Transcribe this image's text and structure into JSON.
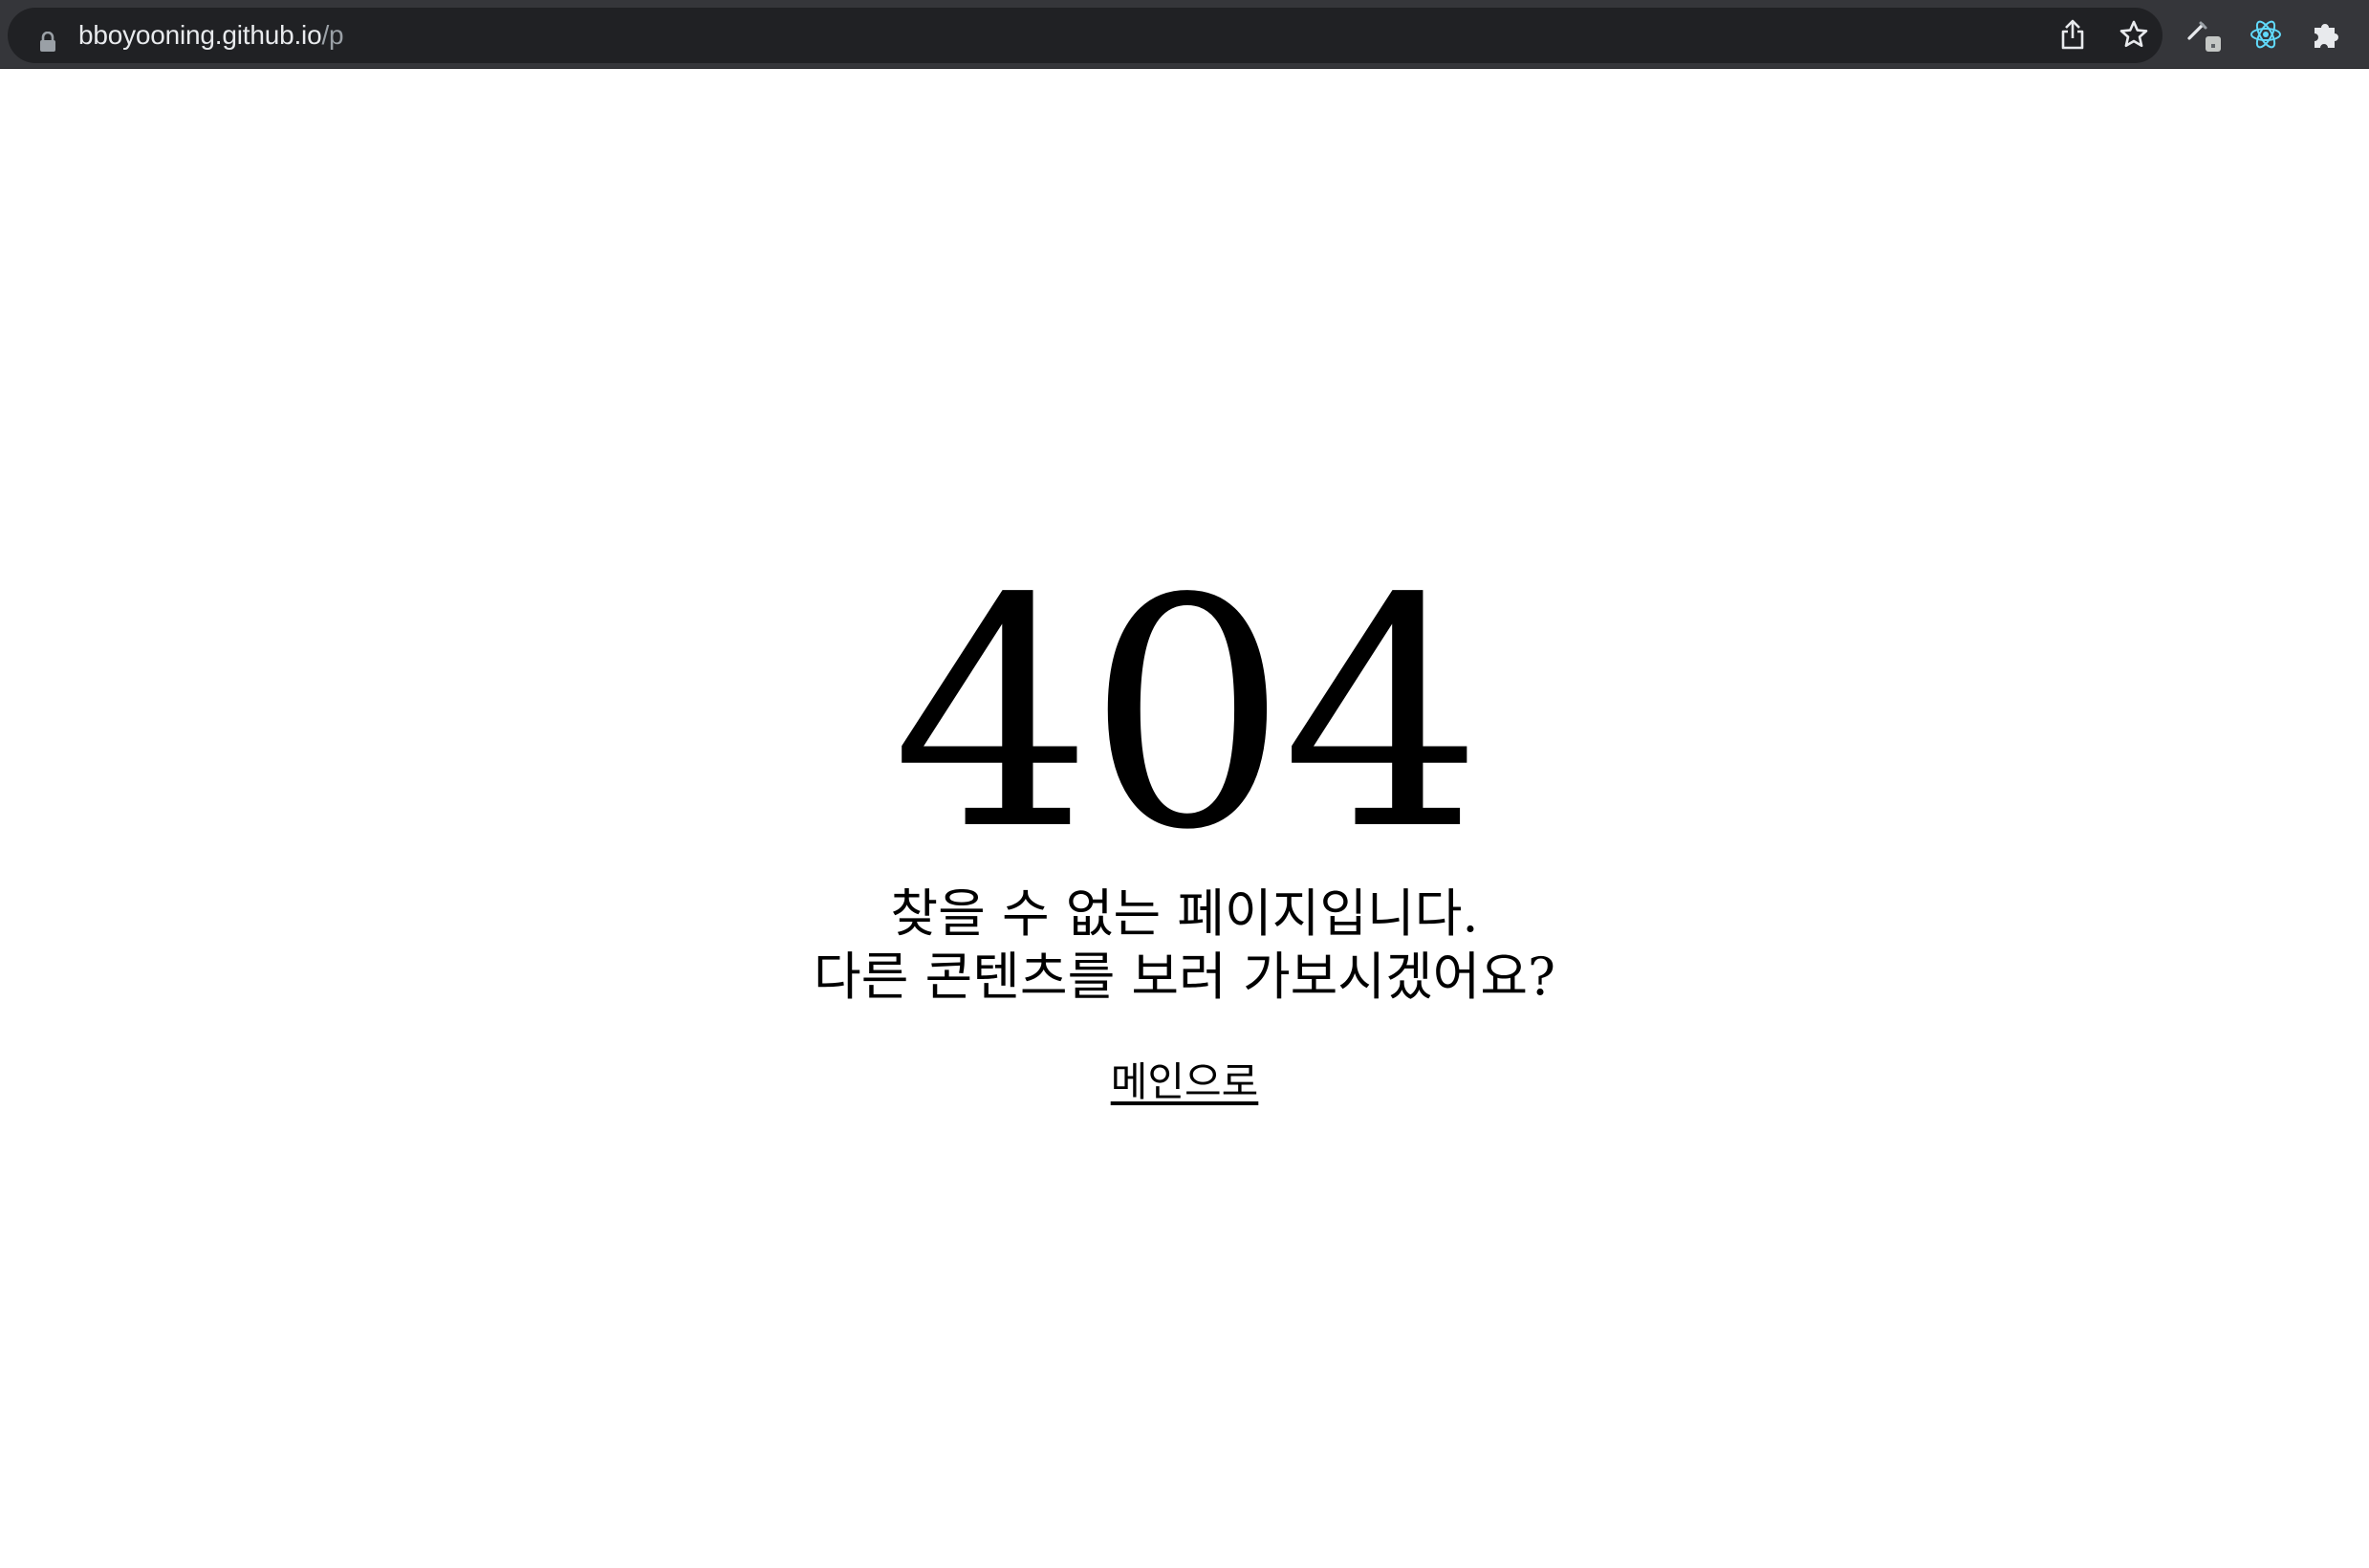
{
  "browser": {
    "url_host": "bboyooning.github.io",
    "url_path": "/p",
    "icons": {
      "lock": "lock-icon",
      "share": "share-icon",
      "bookmark": "star-icon",
      "extension_1": "pen-icon",
      "extension_2": "react-icon",
      "extensions_menu": "puzzle-icon"
    },
    "colors": {
      "toolbar": "#35363a",
      "omnibox": "#202124",
      "url_text": "#e8eaed",
      "url_path": "#9aa0a6",
      "react_accent": "#61dafb"
    }
  },
  "page": {
    "error_code": "404",
    "message_line_1": "찾을 수 없는 페이지입니다.",
    "message_line_2": "다른 콘텐츠를 보러 가보시겠어요?",
    "home_link_label": "메인으로"
  }
}
